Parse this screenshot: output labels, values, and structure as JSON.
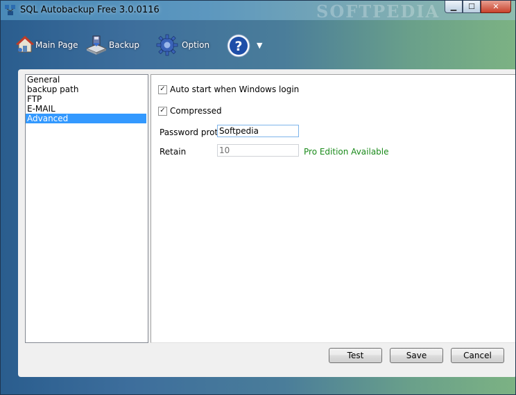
{
  "window": {
    "title": "SQL Autobackup Free 3.0.0116",
    "watermark": "SOFTPEDIA"
  },
  "window_controls": {
    "minimize": "▁",
    "maximize": "☐",
    "close": "✕"
  },
  "toolbar": {
    "main_page": "Main Page",
    "backup": "Backup",
    "option": "Option",
    "help_icon": "question-mark-icon",
    "dropdown": "▼"
  },
  "nav": {
    "items": [
      {
        "label": "General"
      },
      {
        "label": "backup path"
      },
      {
        "label": "FTP"
      },
      {
        "label": "E-MAIL"
      },
      {
        "label": "Advanced"
      }
    ],
    "selected": "Advanced"
  },
  "advanced": {
    "auto_start_label": "Auto start when Windows login",
    "auto_start_checked": true,
    "compressed_label": "Compressed",
    "compressed_checked": true,
    "password_label": "Password protect",
    "password_value": "Softpedia",
    "retain_label": "Retain",
    "retain_value": "10",
    "pro_notice": "Pro Edition Available"
  },
  "buttons": {
    "test": "Test",
    "save": "Save",
    "cancel": "Cancel"
  },
  "colors": {
    "selection": "#3399ff",
    "pro_text": "#1a8a1a"
  }
}
